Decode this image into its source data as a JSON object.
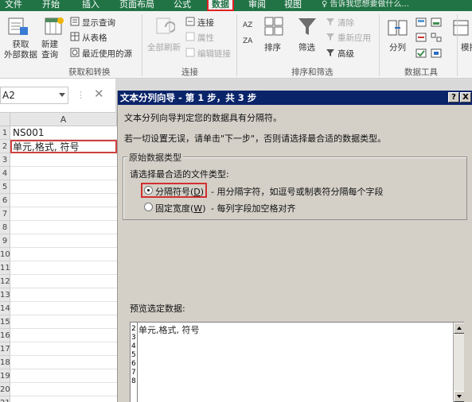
{
  "ribbon_tabs": [
    {
      "label": "文件"
    },
    {
      "label": "开始"
    },
    {
      "label": "插入"
    },
    {
      "label": "页面布局"
    },
    {
      "label": "公式"
    },
    {
      "label": "数据"
    },
    {
      "label": "审阅"
    },
    {
      "label": "视图"
    }
  ],
  "active_tab": "数据",
  "tell_me": "♀ 告诉我您想要做什么...",
  "groups": {
    "get_transform": {
      "label": "获取和转换",
      "get_data": "获取\n外部数据",
      "new_query": "新建\n查询",
      "show_queries": "显示查询",
      "from_table": "从表格",
      "recent_sources": "最近使用的源"
    },
    "connections": {
      "label": "连接",
      "refresh_all": "全部刷新",
      "connections": "连接",
      "properties": "属性",
      "edit_links": "编辑链接"
    },
    "sort_filter": {
      "label": "排序和筛选",
      "sort": "排序",
      "filter": "筛选",
      "clear": "清除",
      "reapply": "重新应用",
      "advanced": "高级"
    },
    "data_tools": {
      "label": "数据工具",
      "split": "分列",
      "model": "模拟"
    }
  },
  "formula_bar": {
    "name_box": "A2"
  },
  "sheet": {
    "column_a": "A",
    "rows": [
      {
        "n": "1",
        "a": "NS001"
      },
      {
        "n": "2",
        "a": "单元,格式, 符号"
      },
      {
        "n": "3",
        "a": ""
      },
      {
        "n": "4",
        "a": ""
      },
      {
        "n": "5",
        "a": ""
      },
      {
        "n": "6",
        "a": ""
      },
      {
        "n": "7",
        "a": ""
      },
      {
        "n": "8",
        "a": ""
      },
      {
        "n": "9",
        "a": ""
      },
      {
        "n": "10",
        "a": ""
      },
      {
        "n": "11",
        "a": ""
      },
      {
        "n": "12",
        "a": ""
      },
      {
        "n": "13",
        "a": ""
      },
      {
        "n": "14",
        "a": ""
      },
      {
        "n": "15",
        "a": ""
      },
      {
        "n": "16",
        "a": ""
      },
      {
        "n": "17",
        "a": ""
      },
      {
        "n": "18",
        "a": ""
      },
      {
        "n": "19",
        "a": ""
      },
      {
        "n": "20",
        "a": ""
      },
      {
        "n": "21",
        "a": ""
      }
    ]
  },
  "dialog": {
    "title": "文本分列向导 - 第 1 步，共 3 步",
    "help": "?",
    "close": "X",
    "line1": "文本分列向导判定您的数据具有分隔符。",
    "line2": "若一切设置无误，请单击\"下一步\"，否则请选择最合适的数据类型。",
    "group_label": "原始数据类型",
    "choose_label": "请选择最合适的文件类型:",
    "option1_label": "分隔符号(",
    "option1_key": "D",
    "option1_desc": "- 用分隔字符，如逗号或制表符分隔每个字段",
    "option2_label": "固定宽度(",
    "option2_key": "W",
    "option2_desc": "- 每列字段加空格对齐",
    "preview_label": "预览选定数据:",
    "preview_line": "单元,格式, 符号",
    "preview_nums": [
      "2",
      "3",
      "4",
      "5",
      "6",
      "7",
      "8"
    ]
  }
}
